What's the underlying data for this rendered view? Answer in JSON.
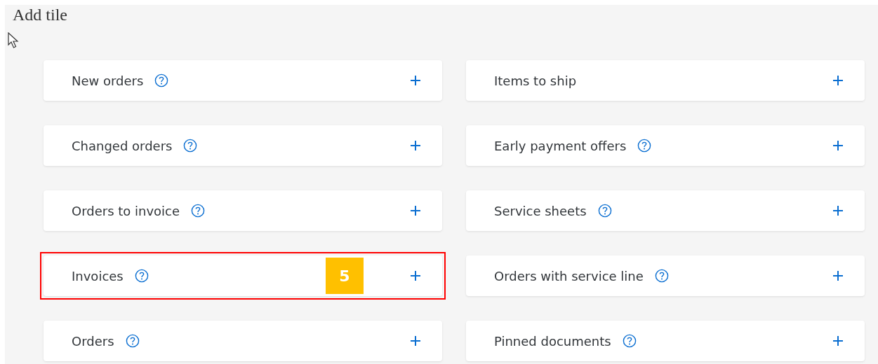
{
  "title": "Add tile",
  "tiles": [
    {
      "label": "New orders",
      "help": true,
      "highlighted": false
    },
    {
      "label": "Items to ship",
      "help": false,
      "highlighted": false
    },
    {
      "label": "Changed orders",
      "help": true,
      "highlighted": false
    },
    {
      "label": "Early payment offers",
      "help": true,
      "highlighted": false
    },
    {
      "label": "Orders to invoice",
      "help": true,
      "highlighted": false
    },
    {
      "label": "Service sheets",
      "help": true,
      "highlighted": false
    },
    {
      "label": "Invoices",
      "help": true,
      "highlighted": true,
      "badge": "5"
    },
    {
      "label": "Orders with service line",
      "help": true,
      "highlighted": false
    },
    {
      "label": "Orders",
      "help": true,
      "highlighted": false
    },
    {
      "label": "Pinned documents",
      "help": true,
      "highlighted": false
    }
  ]
}
